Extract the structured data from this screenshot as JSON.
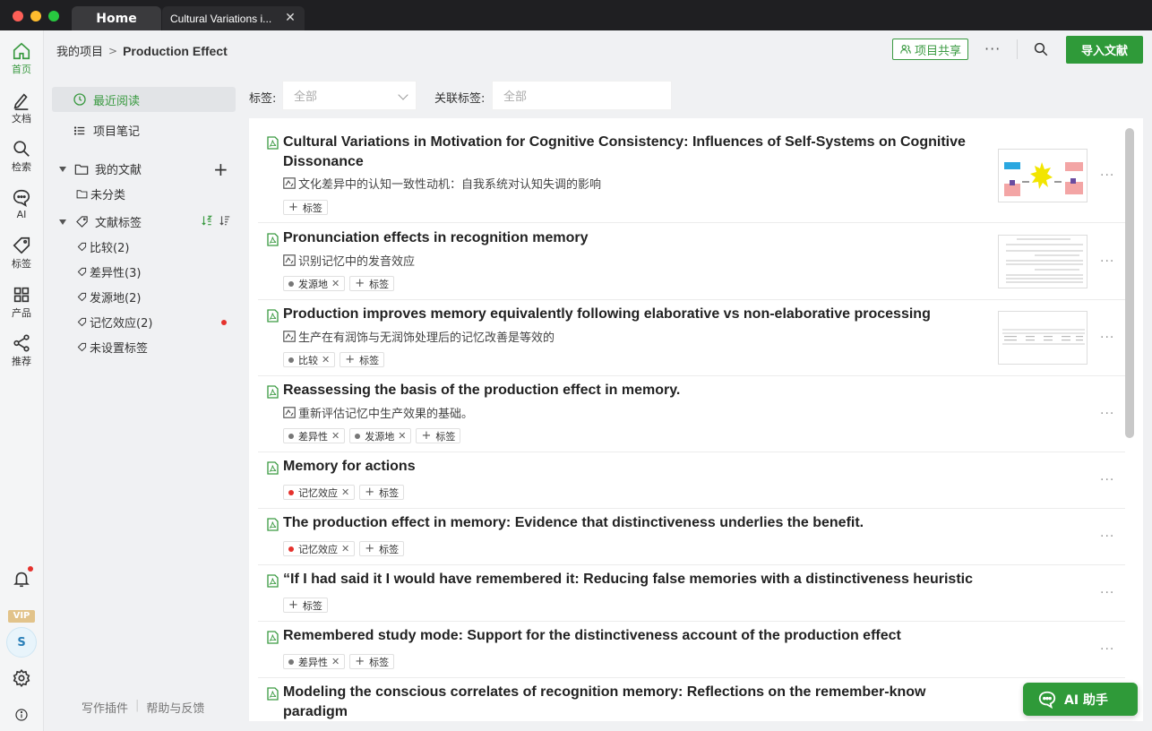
{
  "tabs": [
    {
      "label": "Home"
    },
    {
      "label": "Cultural Variations i..."
    }
  ],
  "leftnav": {
    "items": [
      {
        "label": "首页",
        "icon": "home-icon"
      },
      {
        "label": "文档",
        "icon": "edit-icon"
      },
      {
        "label": "检索",
        "icon": "search-icon"
      },
      {
        "label": "AI",
        "icon": "chat-icon"
      },
      {
        "label": "标签",
        "icon": "tag-icon"
      },
      {
        "label": "产品",
        "icon": "grid-icon"
      },
      {
        "label": "推荐",
        "icon": "share-icon"
      }
    ],
    "vip": "VIP",
    "avatar": "S"
  },
  "header": {
    "breadcrumb_root": "我的项目",
    "breadcrumb_current": "Production Effect",
    "share_label": "项目共享",
    "more_label": "···",
    "import_label": "导入文献"
  },
  "sidebar": {
    "recent": "最近阅读",
    "notes": "项目笔记",
    "my_docs": "我的文献",
    "uncategorized": "未分类",
    "doc_tags": "文献标签",
    "tags": [
      {
        "label": "比较(2)"
      },
      {
        "label": "差异性(3)"
      },
      {
        "label": "发源地(2)"
      },
      {
        "label": "记忆效应(2)"
      },
      {
        "label": "未设置标签"
      }
    ],
    "footer": {
      "plugin": "写作插件",
      "help": "帮助与反馈"
    }
  },
  "filters": {
    "tag_label": "标签:",
    "tag_value": "全部",
    "related_label": "关联标签:",
    "related_value": "全部"
  },
  "add_tag_label": "标签",
  "documents": [
    {
      "title": "Cultural Variations in Motivation for Cognitive Consistency: Influences of Self-Systems on Cognitive Dissonance",
      "subtitle": "文化差异中的认知一致性动机：自我系统对认知失调的影响",
      "tags": []
    },
    {
      "title": "Pronunciation effects in recognition memory",
      "subtitle": "识别记忆中的发音效应",
      "tags": [
        {
          "label": "发源地"
        }
      ]
    },
    {
      "title": "Production improves memory equivalently following elaborative vs non-elaborative processing",
      "subtitle": "生产在有润饰与无润饰处理后的记忆改善是等效的",
      "tags": [
        {
          "label": "比较"
        }
      ]
    },
    {
      "title": "Reassessing the basis of the production effect in memory.",
      "subtitle": "重新评估记忆中生产效果的基础。",
      "tags": [
        {
          "label": "差异性"
        },
        {
          "label": "发源地"
        }
      ]
    },
    {
      "title": "Memory for actions",
      "tags": [
        {
          "label": "记忆效应"
        }
      ]
    },
    {
      "title": "The production effect in memory: Evidence that distinctiveness underlies the benefit.",
      "tags": [
        {
          "label": "记忆效应"
        }
      ]
    },
    {
      "title": "“If I had said it I would have remembered it: Reducing false memories with a distinctiveness heuristic",
      "tags": []
    },
    {
      "title": "Remembered study mode: Support for the distinctiveness account of the production effect",
      "tags": [
        {
          "label": "差异性"
        }
      ]
    },
    {
      "title": "Modeling the conscious correlates of recognition memory: Reflections on the remember-know paradigm",
      "tags": []
    }
  ],
  "ai_button": "AI 助手",
  "colors": {
    "accent": "#2f9a39",
    "badge_red": "#e5322d"
  }
}
